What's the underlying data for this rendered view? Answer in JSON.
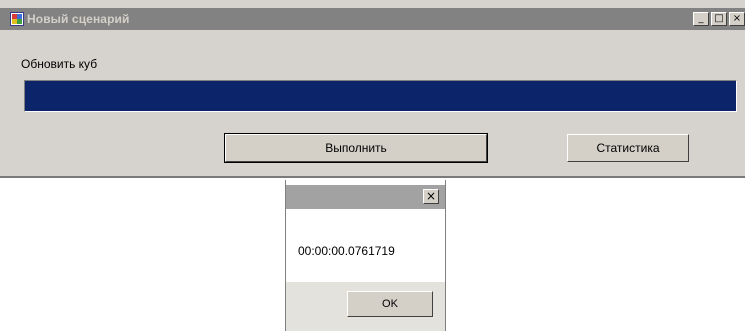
{
  "window": {
    "title": "Новый сценарий",
    "caption_buttons": {
      "minimize": "_",
      "maximize": "□",
      "close": "×"
    }
  },
  "main": {
    "label": "Обновить куб",
    "progress": {
      "value_percent": 100,
      "color": "#0b246a"
    },
    "run_button": "Выполнить",
    "stats_button": "Статистика"
  },
  "dialog": {
    "close": "×",
    "message": "00:00:00.0761719",
    "ok_button": "OK"
  },
  "colors": {
    "window_bg": "#d6d3ce",
    "titlebar_inactive": "#828282",
    "progress_fill": "#0b246a"
  }
}
